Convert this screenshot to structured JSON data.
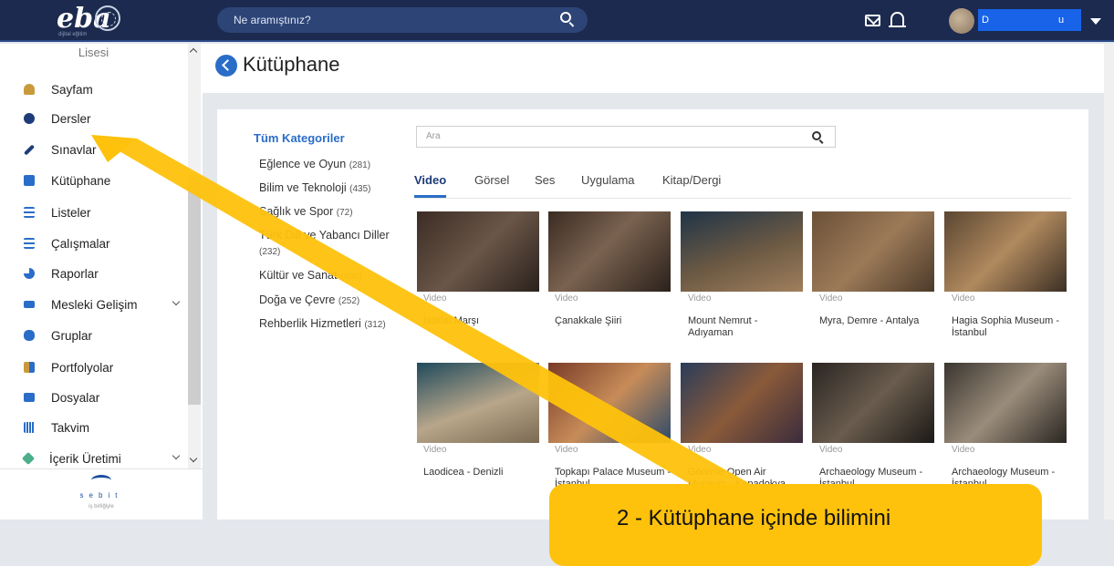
{
  "topbar": {
    "logo_text": "eba",
    "logo_sub": "dijital eğitim",
    "search_placeholder": "Ne aramıştınız?",
    "user_initial": "D",
    "user_suffix": "u"
  },
  "sidebar": {
    "school": "Lisesi",
    "items": [
      {
        "label": "Sayfam",
        "icon": "person-icon"
      },
      {
        "label": "Dersler",
        "icon": "play-circle-icon"
      },
      {
        "label": "Sınavlar",
        "icon": "pencil-icon"
      },
      {
        "label": "Kütüphane",
        "icon": "library-icon"
      },
      {
        "label": "Listeler",
        "icon": "list-icon"
      },
      {
        "label": "Çalışmalar",
        "icon": "search-list-icon"
      },
      {
        "label": "Raporlar",
        "icon": "pie-chart-icon"
      },
      {
        "label": "Mesleki Gelişim",
        "icon": "graduation-cap-icon"
      },
      {
        "label": "Gruplar",
        "icon": "group-icon"
      },
      {
        "label": "Portfolyolar",
        "icon": "user-folder-icon"
      },
      {
        "label": "Dosyalar",
        "icon": "folder-icon"
      },
      {
        "label": "Takvim",
        "icon": "calendar-icon"
      },
      {
        "label": "İçerik Üretimi",
        "icon": "tools-icon"
      }
    ],
    "footer_brand": "sebit",
    "footer_tagline": "iş birliğiyle"
  },
  "page": {
    "title": "Kütüphane"
  },
  "library": {
    "categories_title": "Tüm Kategoriler",
    "categories": [
      {
        "name": "Eğlence ve Oyun",
        "count": "(281)"
      },
      {
        "name": "Bilim ve Teknoloji",
        "count": "(435)"
      },
      {
        "name": "Sağlık ve Spor",
        "count": "(72)"
      },
      {
        "name": "Türk Dili ve Yabancı Diller",
        "count": "(232)"
      },
      {
        "name": "Kültür ve Sanat",
        "count": "(480)"
      },
      {
        "name": "Doğa ve Çevre",
        "count": "(252)"
      },
      {
        "name": "Rehberlik Hizmetleri",
        "count": "(312)"
      }
    ],
    "search_placeholder": "Ara",
    "tabs": [
      "Video",
      "Görsel",
      "Ses",
      "Uygulama",
      "Kitap/Dergi"
    ],
    "active_tab": "Video",
    "items": [
      {
        "type": "Video",
        "title": "İstiklal Marşı"
      },
      {
        "type": "Video",
        "title": "Çanakkale Şiiri"
      },
      {
        "type": "Video",
        "title": "Mount Nemrut - Adıyaman"
      },
      {
        "type": "Video",
        "title": "Myra, Demre - Antalya"
      },
      {
        "type": "Video",
        "title": "Hagia Sophia Museum - İstanbul"
      },
      {
        "type": "Video",
        "title": "Laodicea - Denizli"
      },
      {
        "type": "Video",
        "title": "Topkapı Palace Museum - İstanbul"
      },
      {
        "type": "Video",
        "title": "Göreme Open Air Museum - Kapadokya"
      },
      {
        "type": "Video",
        "title": "Archaeology Museum - İstanbul"
      },
      {
        "type": "Video",
        "title": "Archaeology Museum - İstanbul"
      }
    ]
  },
  "overlay": {
    "text": "2 - Kütüphane içinde bilimini"
  }
}
